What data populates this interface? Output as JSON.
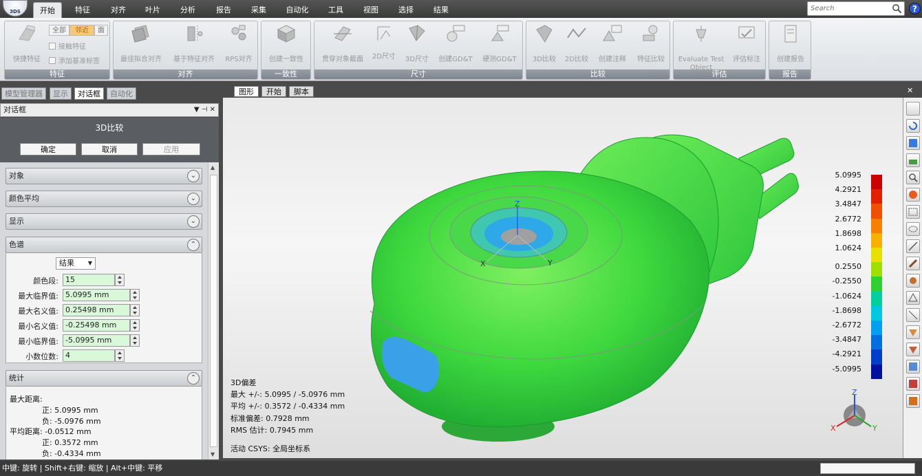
{
  "app": {
    "logo_text": "3DS"
  },
  "menu": {
    "tabs": [
      {
        "label": "开始",
        "active": true
      },
      {
        "label": "特征"
      },
      {
        "label": "对齐"
      },
      {
        "label": "叶片"
      },
      {
        "label": "分析"
      },
      {
        "label": "报告"
      },
      {
        "label": "采集"
      },
      {
        "label": "自动化"
      },
      {
        "label": "工具"
      },
      {
        "label": "视图"
      },
      {
        "label": "选择"
      },
      {
        "label": "结果"
      }
    ],
    "search_placeholder": "Search",
    "help": "?"
  },
  "ribbon": {
    "groups": [
      {
        "label": "特征",
        "buttons": [
          "快捷特征"
        ],
        "segments": [
          "全部",
          "邻近",
          "面"
        ],
        "checks": [
          "接触特征",
          "添加基准标签"
        ]
      },
      {
        "label": "对齐",
        "buttons": [
          "最佳拟合对齐",
          "基于特征对齐",
          "RPS对齐"
        ]
      },
      {
        "label": "一致性",
        "buttons": [
          "创建一致性"
        ]
      },
      {
        "label": "尺寸",
        "buttons": [
          "贯穿对象截面",
          "2D尺寸",
          "3D尺寸",
          "创建GD&T",
          "硬测GD&T"
        ]
      },
      {
        "label": "比较",
        "buttons": [
          "3D比较",
          "2D比较",
          "创建注释",
          "特征比较"
        ]
      },
      {
        "label": "评估",
        "buttons": [
          "Evaluate Test Object",
          "评估标注"
        ]
      },
      {
        "label": "报告",
        "buttons": [
          "创建报告"
        ]
      }
    ]
  },
  "left_panel": {
    "tabs": [
      "模型管理器",
      "显示",
      "对话框",
      "自动化"
    ],
    "active_tab": "对话框",
    "header": "对话框",
    "header_controls": "▼ ⊣ ✕",
    "dialog_title": "3D比较",
    "buttons": {
      "ok": "确定",
      "cancel": "取消",
      "apply": "应用"
    },
    "sections": [
      "对象",
      "颜色平均",
      "显示",
      "色谱",
      "统计"
    ],
    "color_spectrum": {
      "mode": "结果",
      "fields": [
        {
          "label": "颜色段:",
          "value": "15"
        },
        {
          "label": "最大临界值:",
          "value": "5.0995 mm"
        },
        {
          "label": "最大名义值:",
          "value": "0.25498 mm"
        },
        {
          "label": "最小名义值:",
          "value": "-0.25498 mm"
        },
        {
          "label": "最小临界值:",
          "value": "-5.0995 mm"
        },
        {
          "label": "小数位数:",
          "value": "4"
        }
      ]
    },
    "stats": {
      "max_label": "最大距离:",
      "max_pos": "正: 5.0995 mm",
      "max_neg": "负: -5.0976 mm",
      "avg_label": "平均距离: -0.0512 mm",
      "avg_pos": "正: 0.3572 mm",
      "avg_neg": "负: -0.4334 mm"
    }
  },
  "viewport": {
    "tabs": [
      "图形",
      "开始",
      "脚本"
    ],
    "active_tab": "图形",
    "legend": {
      "values": [
        "5.0995",
        "4.2921",
        "3.4847",
        "2.6772",
        "1.8698",
        "1.0624",
        "0.2550",
        "-0.2550",
        "-1.0624",
        "-1.8698",
        "-2.6772",
        "-3.4847",
        "-4.2921",
        "-5.0995"
      ],
      "colors": [
        "#cc0000",
        "#e02000",
        "#f05000",
        "#f88000",
        "#f8b000",
        "#e8e000",
        "#a0e000",
        "#30d030",
        "#00d0a0",
        "#00c8e0",
        "#00a0f0",
        "#0070e0",
        "#0040c8",
        "#0010a0"
      ]
    },
    "info": {
      "title": "3D偏差",
      "max": "最大 +/-: 5.0995 / -5.0976 mm",
      "avg": "平均 +/-: 0.3572 / -0.4334 mm",
      "std": "标准偏差: 0.7928 mm",
      "rms": "RMS 估计: 0.7945 mm",
      "csys": "活动 CSYS: 全局坐标系"
    },
    "axes": {
      "x": "X",
      "y": "Y",
      "z": "Z"
    }
  },
  "statusbar": {
    "hint": "中键: 旋转 | Shift+右键: 缩放 | Alt+中键: 平移"
  }
}
